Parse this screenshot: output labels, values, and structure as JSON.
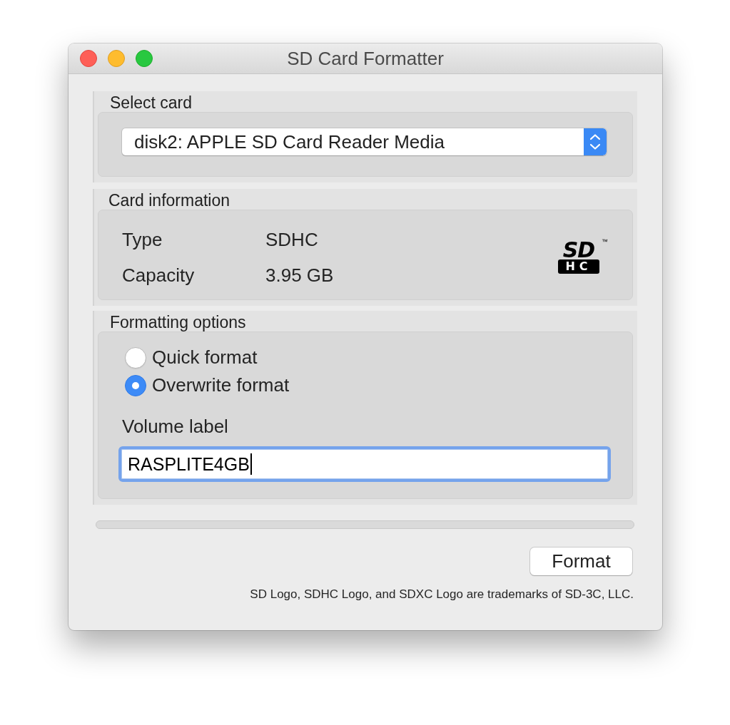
{
  "window": {
    "title": "SD Card Formatter"
  },
  "select_card": {
    "title": "Select card",
    "device": {
      "value": "disk2: APPLE SD Card Reader Media"
    }
  },
  "card_information": {
    "title": "Card information",
    "fields": [
      {
        "label": "Type",
        "value": "SDHC"
      },
      {
        "label": "Capacity",
        "value": "3.95 GB"
      }
    ],
    "logo": {
      "text": "SD",
      "badge": "HC",
      "trademark": "™"
    }
  },
  "formatting_options": {
    "title": "Formatting options",
    "options": [
      {
        "label": "Quick format",
        "selected": false
      },
      {
        "label": "Overwrite format",
        "selected": true
      }
    ],
    "volume_label": {
      "label": "Volume label",
      "value": "RASPLITE4GB",
      "focused": true
    }
  },
  "progress": {
    "level": 0
  },
  "buttons": [
    "Format"
  ],
  "footer": "SD Logo, SDHC Logo, and SDXC Logo are trademarks of SD-3C, LLC."
}
